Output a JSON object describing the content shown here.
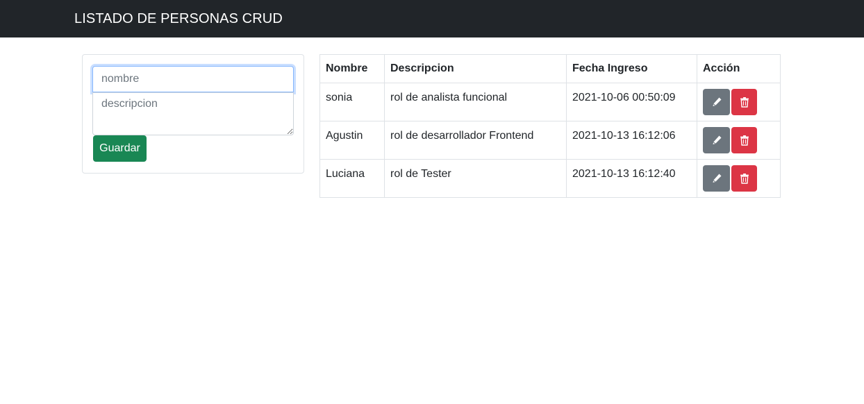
{
  "navbar": {
    "brand": "LISTADO DE PERSONAS CRUD"
  },
  "form": {
    "nombre_placeholder": "nombre",
    "descripcion_placeholder": "descripcion",
    "submit_label": "Guardar"
  },
  "table": {
    "headers": {
      "nombre": "Nombre",
      "descripcion": "Descripcion",
      "fecha": "Fecha Ingreso",
      "accion": "Acción"
    },
    "rows": [
      {
        "nombre": "sonia",
        "descripcion": "rol de analista funcional",
        "fecha": "2021-10-06 00:50:09"
      },
      {
        "nombre": "Agustin",
        "descripcion": "rol de desarrollador Frontend",
        "fecha": "2021-10-13 16:12:06"
      },
      {
        "nombre": "Luciana",
        "descripcion": "rol de Tester",
        "fecha": "2021-10-13 16:12:40"
      }
    ],
    "row_actions": {
      "edit_icon": "pencil-icon",
      "delete_icon": "trash-icon"
    }
  },
  "colors": {
    "navbar": "#212529",
    "save": "#198754",
    "edit": "#6c757d",
    "delete": "#dc3545"
  }
}
